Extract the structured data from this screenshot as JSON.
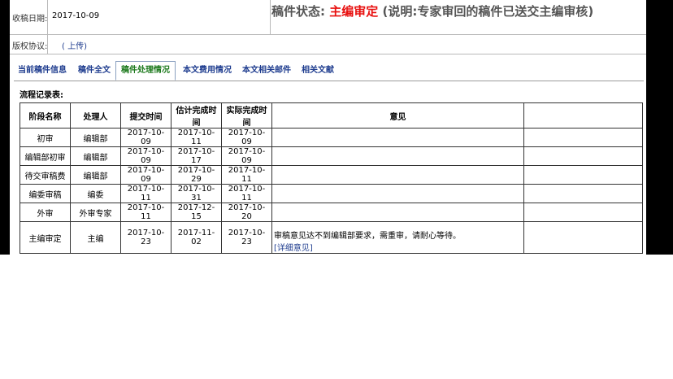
{
  "header": {
    "received_label": "收稿日期:",
    "received_value": "2017-10-09",
    "status_prefix": "稿件状态:",
    "status_value": "主编审定",
    "status_note": "(说明:专家审回的稿件已送交主编审核)",
    "copyright_label": "版权协议:",
    "copyright_link": "( 上传)"
  },
  "tabs": [
    {
      "label": "当前稿件信息"
    },
    {
      "label": "稿件全文"
    },
    {
      "label": "稿件处理情况"
    },
    {
      "label": "本文费用情况"
    },
    {
      "label": "本文相关邮件"
    },
    {
      "label": "相关文献"
    }
  ],
  "flow": {
    "title": "流程记录表:",
    "columns": [
      "阶段名称",
      "处理人",
      "提交时间",
      "估计完成时间",
      "实际完成时间",
      "意见"
    ],
    "rows": [
      {
        "stage": "初审",
        "handler": "编辑部",
        "submit": "2017-10-09",
        "estimate": "2017-10-11",
        "actual": "2017-10-09",
        "opinion": "",
        "link": ""
      },
      {
        "stage": "编辑部初审",
        "handler": "编辑部",
        "submit": "2017-10-09",
        "estimate": "2017-10-17",
        "actual": "2017-10-09",
        "opinion": "",
        "link": ""
      },
      {
        "stage": "待交审稿费",
        "handler": "编辑部",
        "submit": "2017-10-09",
        "estimate": "2017-10-29",
        "actual": "2017-10-11",
        "opinion": "",
        "link": ""
      },
      {
        "stage": "编委审稿",
        "handler": "编委",
        "submit": "2017-10-11",
        "estimate": "2017-10-31",
        "actual": "2017-10-11",
        "opinion": "",
        "link": ""
      },
      {
        "stage": "外审",
        "handler": "外审专家",
        "submit": "2017-10-11",
        "estimate": "2017-12-15",
        "actual": "2017-10-20",
        "opinion": "",
        "link": ""
      },
      {
        "stage": "主编审定",
        "handler": "主编",
        "submit": "2017-10-23",
        "estimate": "2017-11-02",
        "actual": "2017-10-23",
        "opinion": "审稿意见达不到编辑部要求，需重审，请耐心等待。",
        "link": "[详细意见]"
      }
    ]
  }
}
